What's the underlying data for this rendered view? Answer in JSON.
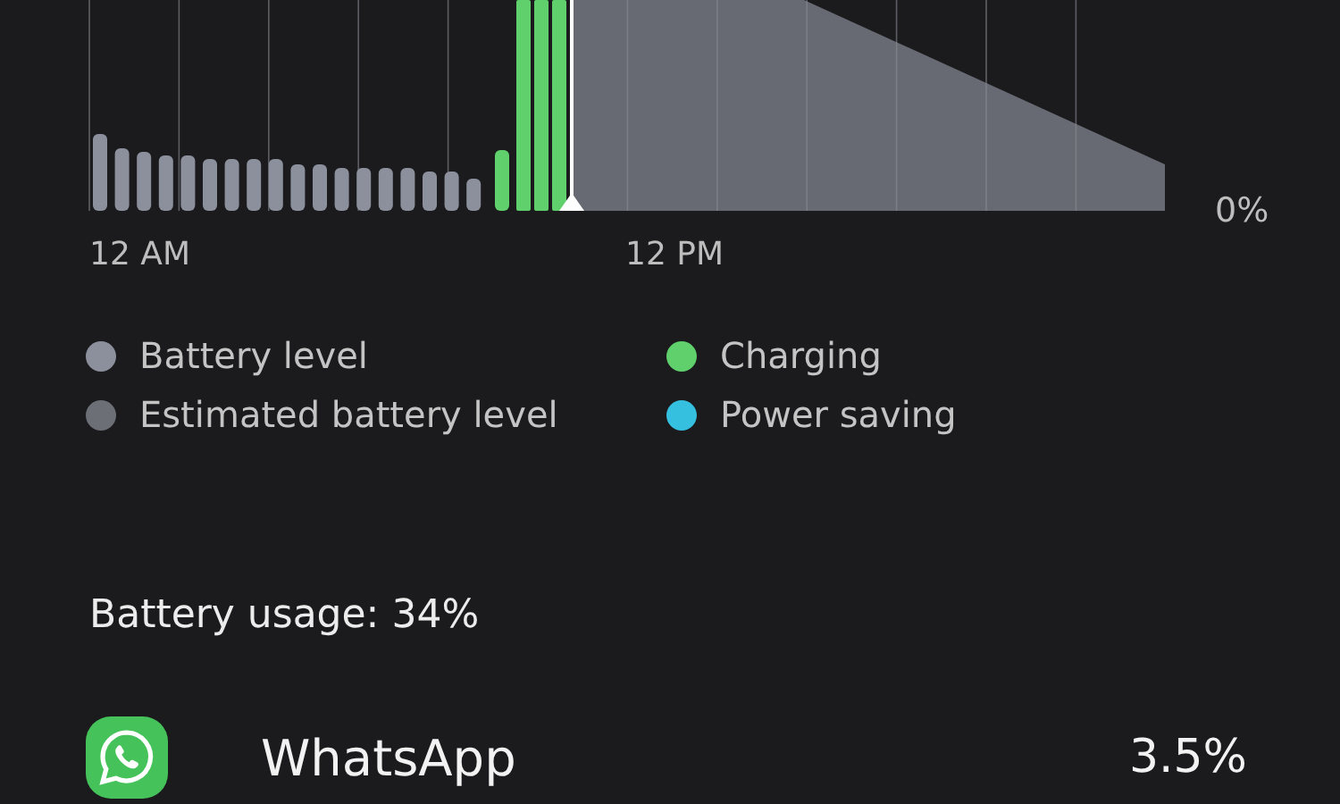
{
  "chart": {
    "axis_labels": [
      "12 AM",
      "12 PM"
    ],
    "y_label": "0%"
  },
  "legend": [
    {
      "label": "Battery level",
      "color": "#8b909c"
    },
    {
      "label": "Charging",
      "color": "#5fd06c"
    },
    {
      "label": "Estimated battery level",
      "color": "#6c6f76"
    },
    {
      "label": "Power saving",
      "color": "#35c0e0"
    }
  ],
  "usage": {
    "title": "Battery usage: 34%"
  },
  "apps": [
    {
      "name": "WhatsApp",
      "percent": "3.5%"
    }
  ]
}
